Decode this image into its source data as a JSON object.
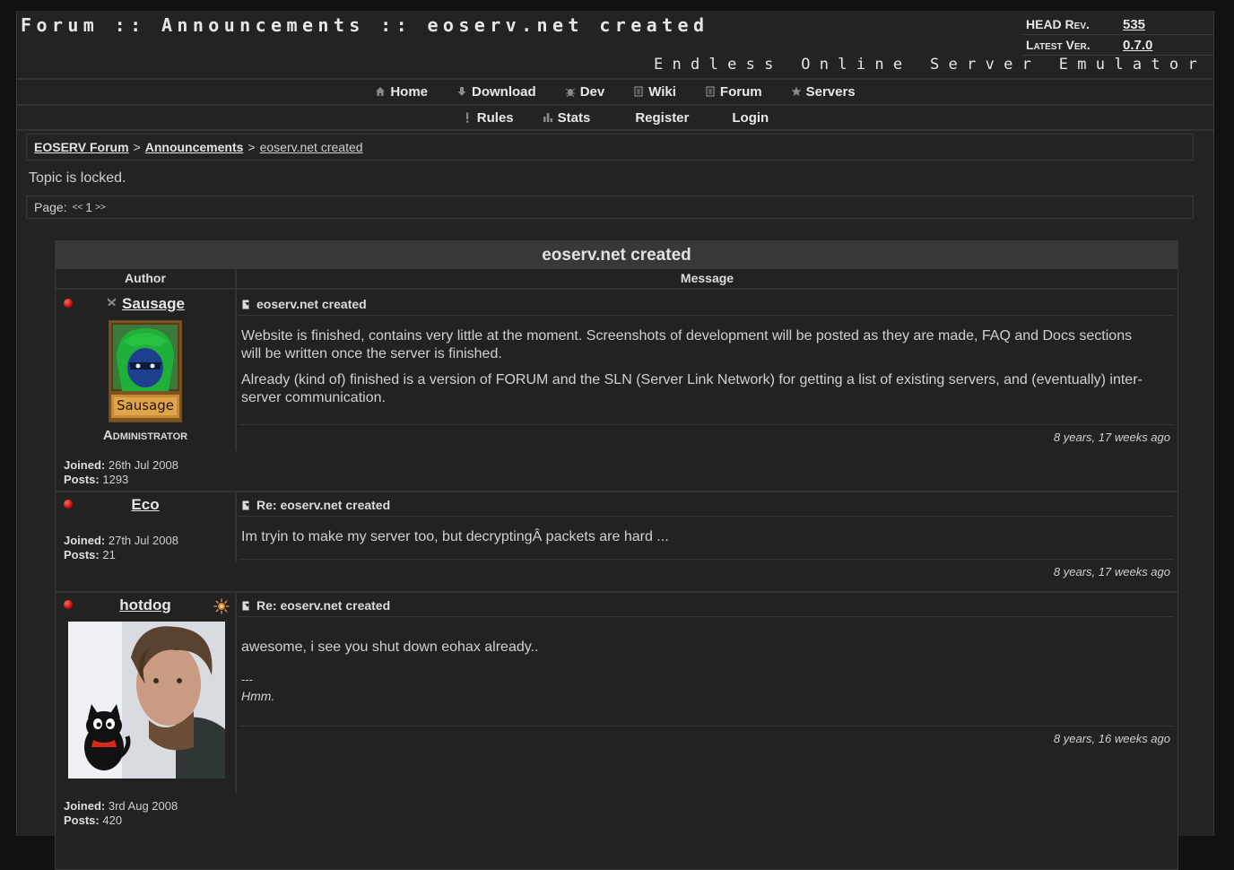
{
  "header": {
    "title": "Forum :: Announcements :: eoserv.net created",
    "head_rev_label": "HEAD Rev.",
    "head_rev_value": "535",
    "latest_ver_label": "Latest Ver.",
    "latest_ver_value": "0.7.0",
    "tagline": "Endless Online Server Emulator"
  },
  "nav": {
    "main": [
      {
        "label": "Home",
        "icon": "home-icon"
      },
      {
        "label": "Download",
        "icon": "download-icon"
      },
      {
        "label": "Dev",
        "icon": "bug-icon"
      },
      {
        "label": "Wiki",
        "icon": "document-icon"
      },
      {
        "label": "Forum",
        "icon": "document-icon"
      },
      {
        "label": "Servers",
        "icon": "star-icon"
      }
    ],
    "sub": [
      {
        "label": "Rules",
        "icon": "exclamation-icon"
      },
      {
        "label": "Stats",
        "icon": "bar-chart-icon"
      },
      {
        "label": "Register"
      },
      {
        "label": "Login"
      }
    ]
  },
  "breadcrumb": {
    "root": "EOSERV Forum",
    "section": "Announcements",
    "current": "eoserv.net created",
    "sep": ">"
  },
  "topic_status": "Topic is locked.",
  "pagination": {
    "label": "Page:",
    "prev": "<<",
    "current": "1",
    "next": ">>"
  },
  "topic": {
    "title": "eoserv.net created",
    "col_author": "Author",
    "col_message": "Message"
  },
  "posts": [
    {
      "author": "Sausage",
      "avatar_label": "Sausage",
      "rank": "Administrator",
      "joined_label": "Joined:",
      "joined": "26th Jul 2008",
      "posts_label": "Posts:",
      "posts": "1293",
      "subject": "eoserv.net created",
      "body": [
        "Website is finished, contains very little at the moment. Screenshots of development will be posted as they are made, FAQ and Docs sections will be written once the server is finished.",
        "Already (kind of) finished is a version of FORUM and the SLN (Server Link Network) for getting a list of existing servers, and (eventually) inter-server communication."
      ],
      "time": "8 years, 17 weeks ago"
    },
    {
      "author": "Eco",
      "joined_label": "Joined:",
      "joined": "27th Jul 2008",
      "posts_label": "Posts:",
      "posts": "21",
      "subject": "Re: eoserv.net created",
      "body": [
        "Im tryin to make my server too, but decryptingÂ packets are hard ..."
      ],
      "time": "8 years, 17 weeks ago"
    },
    {
      "author": "hotdog",
      "joined_label": "Joined:",
      "joined": "3rd Aug 2008",
      "posts_label": "Posts:",
      "posts": "420",
      "subject": "Re: eoserv.net created",
      "body": [
        "awesome, i see you shut down eohax already.."
      ],
      "sig_sep": "---",
      "signature": "Hmm.",
      "time": "8 years, 16 weeks ago"
    }
  ],
  "colors": {
    "page_bg": "#232323",
    "outer_bg": "#111111",
    "text": "#cfcfcf",
    "online": "#c41010"
  }
}
